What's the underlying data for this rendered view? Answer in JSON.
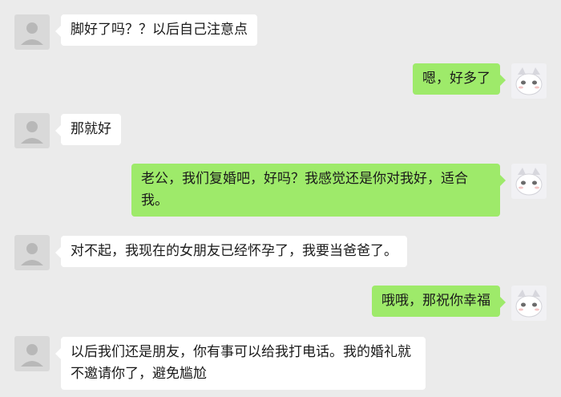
{
  "messages": [
    {
      "side": "left",
      "text": "脚好了吗？？以后自己注意点"
    },
    {
      "side": "right",
      "text": "嗯，好多了"
    },
    {
      "side": "left",
      "text": "那就好"
    },
    {
      "side": "right",
      "text": "老公，我们复婚吧，好吗？我感觉还是你对我好，适合我。"
    },
    {
      "side": "left",
      "text": "对不起，我现在的女朋友已经怀孕了，我要当爸爸了。"
    },
    {
      "side": "right",
      "text": "哦哦，那祝你幸福"
    },
    {
      "side": "left",
      "text": "以后我们还是朋友，你有事可以给我打电话。我的婚礼就不邀请你了，避免尴尬"
    }
  ],
  "colors": {
    "background": "#ebebeb",
    "bubble_left": "#ffffff",
    "bubble_right": "#9eea6a"
  },
  "icons": {
    "left_avatar": "default-user-avatar-icon",
    "right_avatar": "white-cat-avatar-icon"
  }
}
